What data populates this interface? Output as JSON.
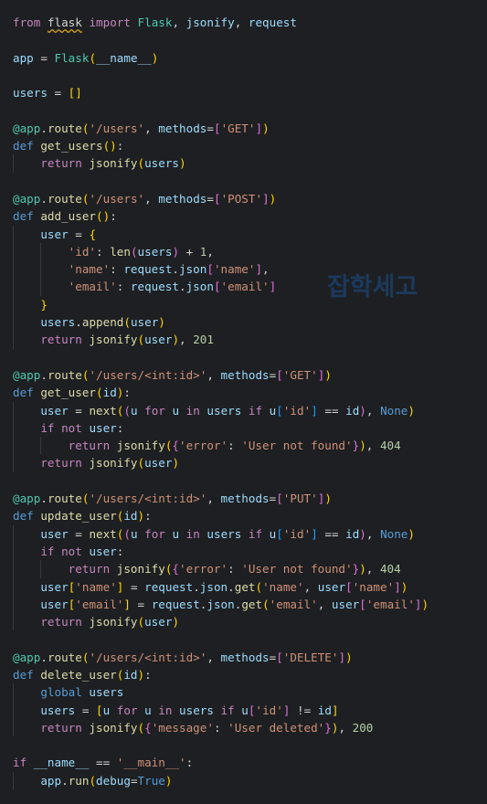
{
  "editor": {
    "language": "python",
    "theme": "dark-plus",
    "background_color": "#1e1f22",
    "default_text_color": "#d4d4d4",
    "indent_guide_color": "#333a40"
  },
  "watermark": {
    "text": "잡학세고",
    "color": "#1b3a5e"
  },
  "code": {
    "l1_from": "from",
    "l1_flask": "flask",
    "l1_import": "import",
    "l1_flaskcls": " Flask",
    "l1_comma1": ", ",
    "l1_jsonify": "jsonify",
    "l1_comma2": ", ",
    "l1_request": "request",
    "l3_app": "app ",
    "l3_eq": "= ",
    "l3_flask": "Flask",
    "l3_open": "(",
    "l3_name": "__name__",
    "l3_close": ")",
    "l5_users": "users ",
    "l5_eq": "= ",
    "l5_brackets": "[]",
    "l7_at": "@app",
    "l7_dot": ".",
    "l7_route": "route",
    "l7_p1": "(",
    "l7_str": "'/users'",
    "l7_comma": ", ",
    "l7_methods": "methods",
    "l7_eq": "=",
    "l7_b1": "[",
    "l7_get": "'GET'",
    "l7_b2": "]",
    "l7_p2": ")",
    "l8_def": "def ",
    "l8_name": "get_users",
    "l8_p": "()",
    "l8_colon": ":",
    "l9_return": "return ",
    "l9_jsonify": "jsonify",
    "l9_p1": "(",
    "l9_users": "users",
    "l9_p2": ")",
    "l11_at": "@app",
    "l11_dot": ".",
    "l11_route": "route",
    "l11_p1": "(",
    "l11_str": "'/users'",
    "l11_comma": ", ",
    "l11_methods": "methods",
    "l11_eq": "=",
    "l11_b1": "[",
    "l11_post": "'POST'",
    "l11_b2": "]",
    "l11_p2": ")",
    "l12_def": "def ",
    "l12_name": "add_user",
    "l12_p": "()",
    "l12_colon": ":",
    "l13_user": "user ",
    "l13_eq": "= ",
    "l13_brace": "{",
    "l14_key": "'id'",
    "l14_colon": ": ",
    "l14_len": "len",
    "l14_p1": "(",
    "l14_users": "users",
    "l14_p2": ")",
    "l14_plus": " + ",
    "l14_num": "1",
    "l14_comma": ",",
    "l15_key": "'name'",
    "l15_colon": ": ",
    "l15_request": "request",
    "l15_dot": ".",
    "l15_json": "json",
    "l15_b1": "[",
    "l15_str": "'name'",
    "l15_b2": "]",
    "l15_comma": ",",
    "l16_key": "'email'",
    "l16_colon": ": ",
    "l16_request": "request",
    "l16_dot": ".",
    "l16_json": "json",
    "l16_b1": "[",
    "l16_str": "'email'",
    "l16_b2": "]",
    "l17_brace": "}",
    "l18_users": "users",
    "l18_dot": ".",
    "l18_append": "append",
    "l18_p1": "(",
    "l18_user": "user",
    "l18_p2": ")",
    "l19_return": "return ",
    "l19_jsonify": "jsonify",
    "l19_p1": "(",
    "l19_user": "user",
    "l19_p2": ")",
    "l19_comma": ", ",
    "l19_num": "201",
    "l21_at": "@app",
    "l21_dot": ".",
    "l21_route": "route",
    "l21_p1": "(",
    "l21_str": "'/users/<int:id>'",
    "l21_comma": ", ",
    "l21_methods": "methods",
    "l21_eq": "=",
    "l21_b1": "[",
    "l21_get": "'GET'",
    "l21_b2": "]",
    "l21_p2": ")",
    "l22_def": "def ",
    "l22_name": "get_user",
    "l22_p1": "(",
    "l22_id": "id",
    "l22_p2": ")",
    "l22_colon": ":",
    "l23_user": "user ",
    "l23_eq": "= ",
    "l23_next": "next",
    "l23_p1": "(",
    "l23_p2": "(",
    "l23_u": "u ",
    "l23_for": "for ",
    "l23_u2": "u ",
    "l23_in": "in ",
    "l23_users": "users ",
    "l23_if": "if ",
    "l23_u3": "u",
    "l23_b1": "[",
    "l23_str": "'id'",
    "l23_b2": "]",
    "l23_eqeq": " == ",
    "l23_id": "id",
    "l23_p3": ")",
    "l23_comma": ", ",
    "l23_none": "None",
    "l23_p4": ")",
    "l24_if": "if ",
    "l24_not": "not ",
    "l24_user": "user",
    "l24_colon": ":",
    "l25_return": "return ",
    "l25_jsonify": "jsonify",
    "l25_p1": "(",
    "l25_brace1": "{",
    "l25_key": "'error'",
    "l25_colon": ": ",
    "l25_val": "'User not found'",
    "l25_brace2": "}",
    "l25_p2": ")",
    "l25_comma": ", ",
    "l25_num": "404",
    "l26_return": "return ",
    "l26_jsonify": "jsonify",
    "l26_p1": "(",
    "l26_user": "user",
    "l26_p2": ")",
    "l28_at": "@app",
    "l28_dot": ".",
    "l28_route": "route",
    "l28_p1": "(",
    "l28_str": "'/users/<int:id>'",
    "l28_comma": ", ",
    "l28_methods": "methods",
    "l28_eq": "=",
    "l28_b1": "[",
    "l28_put": "'PUT'",
    "l28_b2": "]",
    "l28_p2": ")",
    "l29_def": "def ",
    "l29_name": "update_user",
    "l29_p1": "(",
    "l29_id": "id",
    "l29_p2": ")",
    "l29_colon": ":",
    "l33_user": "user",
    "l33_b1": "[",
    "l33_key": "'name'",
    "l33_b2": "]",
    "l33_eq": " = ",
    "l33_request": "request",
    "l33_dot1": ".",
    "l33_json": "json",
    "l33_dot2": ".",
    "l33_get": "get",
    "l33_p1": "(",
    "l33_str": "'name'",
    "l33_comma": ", ",
    "l33_user2": "user",
    "l33_b3": "[",
    "l33_key2": "'name'",
    "l33_b4": "]",
    "l33_p2": ")",
    "l34_user": "user",
    "l34_b1": "[",
    "l34_key": "'email'",
    "l34_b2": "]",
    "l34_eq": " = ",
    "l34_request": "request",
    "l34_dot1": ".",
    "l34_json": "json",
    "l34_dot2": ".",
    "l34_get": "get",
    "l34_p1": "(",
    "l34_str": "'email'",
    "l34_comma": ", ",
    "l34_user2": "user",
    "l34_b3": "[",
    "l34_key2": "'email'",
    "l34_b4": "]",
    "l34_p2": ")",
    "l37_at": "@app",
    "l37_dot": ".",
    "l37_route": "route",
    "l37_p1": "(",
    "l37_str": "'/users/<int:id>'",
    "l37_comma": ", ",
    "l37_methods": "methods",
    "l37_eq": "=",
    "l37_b1": "[",
    "l37_delete": "'DELETE'",
    "l37_b2": "]",
    "l37_p2": ")",
    "l38_def": "def ",
    "l38_name": "delete_user",
    "l38_p1": "(",
    "l38_id": "id",
    "l38_p2": ")",
    "l38_colon": ":",
    "l39_global": "global ",
    "l39_users": "users",
    "l40_users": "users ",
    "l40_eq": "= ",
    "l40_b1": "[",
    "l40_u": "u ",
    "l40_for": "for ",
    "l40_u2": "u ",
    "l40_in": "in ",
    "l40_users2": "users ",
    "l40_if": "if ",
    "l40_u3": "u",
    "l40_b2": "[",
    "l40_str": "'id'",
    "l40_b3": "]",
    "l40_ne": " != ",
    "l40_id": "id",
    "l40_b4": "]",
    "l41_return": "return ",
    "l41_jsonify": "jsonify",
    "l41_p1": "(",
    "l41_brace1": "{",
    "l41_key": "'message'",
    "l41_colon": ": ",
    "l41_val": "'User deleted'",
    "l41_brace2": "}",
    "l41_p2": ")",
    "l41_comma": ", ",
    "l41_num": "200",
    "l43_if": "if ",
    "l43_name": "__name__",
    "l43_eqeq": " == ",
    "l43_main": "'__main__'",
    "l43_colon": ":",
    "l44_app": "app",
    "l44_dot": ".",
    "l44_run": "run",
    "l44_p1": "(",
    "l44_debug": "debug",
    "l44_eq": "=",
    "l44_true": "True",
    "l44_p2": ")"
  }
}
